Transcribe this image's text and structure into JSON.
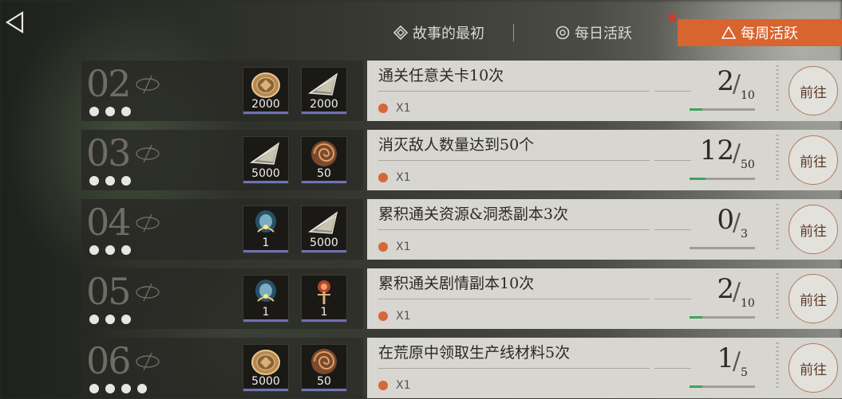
{
  "tabs": [
    {
      "label": "故事的最初",
      "icon": "diamond-icon",
      "active": false
    },
    {
      "label": "每日活跃",
      "icon": "circle-icon",
      "active": false
    },
    {
      "label": "每周活跃",
      "icon": "triangle-icon",
      "active": true
    }
  ],
  "accent_color": "#d8642f",
  "rows": [
    {
      "level": "02",
      "dots": 3,
      "rewards": [
        {
          "icon": "coin-icon",
          "count": "2000"
        },
        {
          "icon": "crystal-shard-icon",
          "count": "2000"
        }
      ],
      "task": "通关任意关卡10次",
      "multiplier": "X1",
      "current": "2",
      "total": "10",
      "progress_fraction": 0.2,
      "button": "前往"
    },
    {
      "level": "03",
      "dots": 3,
      "rewards": [
        {
          "icon": "crystal-shard-icon",
          "count": "5000"
        },
        {
          "icon": "ammonite-icon",
          "count": "50"
        }
      ],
      "task": "消灭敌人数量达到50个",
      "multiplier": "X1",
      "current": "12",
      "total": "50",
      "progress_fraction": 0.24,
      "button": "前往"
    },
    {
      "level": "04",
      "dots": 3,
      "rewards": [
        {
          "icon": "light-orb-icon",
          "count": "1"
        },
        {
          "icon": "crystal-shard-icon",
          "count": "5000"
        }
      ],
      "task": "累积通关资源&洞悉副本3次",
      "multiplier": "X1",
      "current": "0",
      "total": "3",
      "progress_fraction": 0,
      "button": "前往"
    },
    {
      "level": "05",
      "dots": 3,
      "rewards": [
        {
          "icon": "light-orb-icon",
          "count": "1"
        },
        {
          "icon": "gem-key-icon",
          "count": "1"
        }
      ],
      "task": "累积通关剧情副本10次",
      "multiplier": "X1",
      "current": "2",
      "total": "10",
      "progress_fraction": 0.2,
      "button": "前往"
    },
    {
      "level": "06",
      "dots": 4,
      "rewards": [
        {
          "icon": "coin-icon",
          "count": "5000"
        },
        {
          "icon": "ammonite-icon",
          "count": "50"
        }
      ],
      "task": "在荒原中领取生产线材料5次",
      "multiplier": "X1",
      "current": "1",
      "total": "5",
      "progress_fraction": 0.2,
      "button": "前往"
    }
  ]
}
